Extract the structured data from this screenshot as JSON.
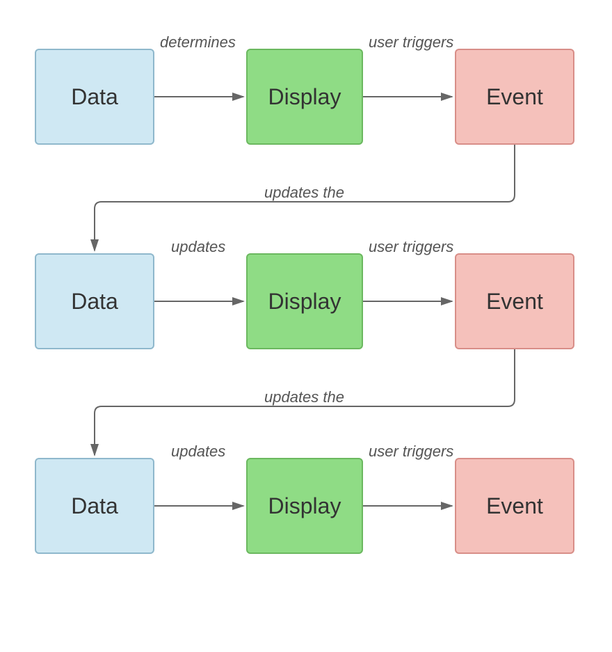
{
  "diagram": {
    "rows": [
      {
        "data_label": "Data",
        "display_label": "Display",
        "event_label": "Event",
        "edge_data_display": "determines",
        "edge_display_event": "user triggers"
      },
      {
        "data_label": "Data",
        "display_label": "Display",
        "event_label": "Event",
        "edge_data_display": "updates",
        "edge_display_event": "user triggers"
      },
      {
        "data_label": "Data",
        "display_label": "Display",
        "event_label": "Event",
        "edge_data_display": "updates",
        "edge_display_event": "user triggers"
      }
    ],
    "return_edges": [
      {
        "label": "updates the"
      },
      {
        "label": "updates the"
      }
    ],
    "colors": {
      "data_fill": "#cfe8f3",
      "data_stroke": "#8fb8cc",
      "display_fill": "#8fdc85",
      "display_stroke": "#6bb85f",
      "event_fill": "#f5c1bb",
      "event_stroke": "#d88e88",
      "arrow": "#666666",
      "label": "#555555"
    }
  }
}
